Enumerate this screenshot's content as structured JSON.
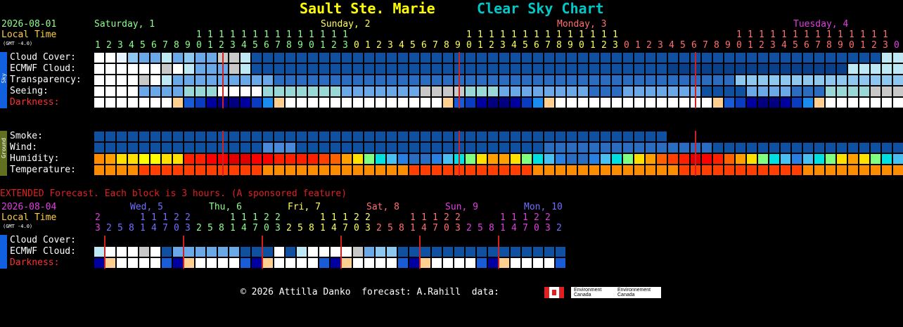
{
  "title_site": "Sault Ste. Marie",
  "title_chart": "Clear Sky Chart",
  "main": {
    "date": "2026-08-01",
    "local_time": "Local Time",
    "gmt": "(GMT -4.0)",
    "days": [
      {
        "label": "Saturday, 1",
        "color": "#90ff90"
      },
      {
        "label": "Sunday, 2",
        "color": "#ffff60"
      },
      {
        "label": "Monday, 3",
        "color": "#ff7070"
      },
      {
        "label": "Tuesday, 4",
        "color": "#e040e0"
      }
    ],
    "sky_side": "Sky",
    "ground_side": "Ground",
    "rows": [
      {
        "label": "Cloud Cover:"
      },
      {
        "label": "ECMWF Cloud:"
      },
      {
        "label": "Transparency:"
      },
      {
        "label": "Seeing:"
      },
      {
        "label": "Darkness:"
      }
    ],
    "ground_rows": [
      {
        "label": "Smoke:"
      },
      {
        "label": "Wind:"
      },
      {
        "label": "Humidity:"
      },
      {
        "label": "Temperature:"
      }
    ]
  },
  "extended": {
    "notice": "EXTENDED Forecast. Each block is 3 hours. (A sponsored feature)",
    "date": "2026-08-04",
    "local_time": "Local Time",
    "gmt": "(GMT -4.0)",
    "days": [
      {
        "label": "Wed, 5",
        "color": "#7070ff"
      },
      {
        "label": "Thu, 6",
        "color": "#90ff90"
      },
      {
        "label": "Fri, 7",
        "color": "#ffff60"
      },
      {
        "label": "Sat, 8",
        "color": "#ff7070"
      },
      {
        "label": "Sun, 9",
        "color": "#e040e0"
      },
      {
        "label": "Mon, 10",
        "color": "#7070ff"
      }
    ],
    "rows": [
      {
        "label": "Cloud Cover:"
      },
      {
        "label": "ECMWF Cloud:"
      },
      {
        "label": "Darkness:"
      }
    ]
  },
  "footer": {
    "text": "© 2026 Attilla Danko  forecast: A.Rahill  data:",
    "env1": "Environment Canada",
    "env2": "Environnement Canada"
  },
  "colors": {
    "title_site": "#ffff00",
    "title_chart": "#00c8c8",
    "date": "#90ff90",
    "local_time": "#ffd040",
    "darkness_label": "#ff3030",
    "notice": "#e02020",
    "ext_date": "#e040e0",
    "sky_bar": "#1060e0",
    "ground_bar": "#607020"
  }
}
